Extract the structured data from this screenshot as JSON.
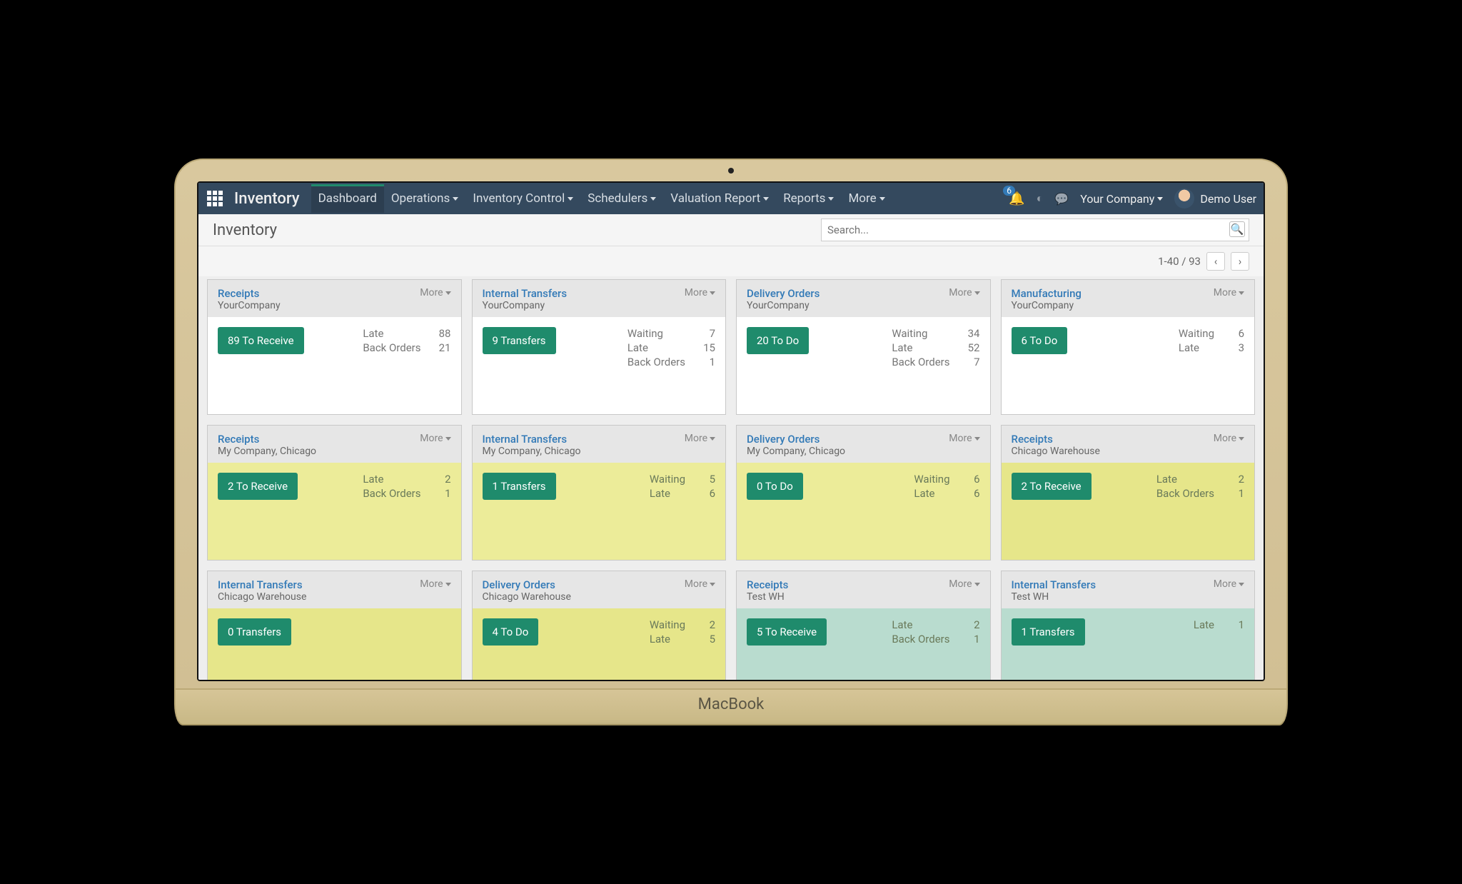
{
  "nav": {
    "brand": "Inventory",
    "items": [
      {
        "label": "Dashboard",
        "active": true,
        "caret": false
      },
      {
        "label": "Operations",
        "active": false,
        "caret": true
      },
      {
        "label": "Inventory Control",
        "active": false,
        "caret": true
      },
      {
        "label": "Schedulers",
        "active": false,
        "caret": true
      },
      {
        "label": "Valuation Report",
        "active": false,
        "caret": true
      },
      {
        "label": "Reports",
        "active": false,
        "caret": true
      },
      {
        "label": "More",
        "active": false,
        "caret": true
      }
    ],
    "notif_count": "6",
    "company": "Your Company",
    "user": "Demo User"
  },
  "page": {
    "title": "Inventory",
    "search_placeholder": "Search...",
    "pager": "1-40 / 93"
  },
  "more_label": "More",
  "cards": [
    {
      "title": "Receipts",
      "sub": "YourCompany",
      "btn": "89 To Receive",
      "tint": "",
      "stats": [
        {
          "k": "Late",
          "v": "88"
        },
        {
          "k": "Back Orders",
          "v": "21"
        }
      ]
    },
    {
      "title": "Internal Transfers",
      "sub": "YourCompany",
      "btn": "9 Transfers",
      "tint": "",
      "stats": [
        {
          "k": "Waiting",
          "v": "7"
        },
        {
          "k": "Late",
          "v": "15"
        },
        {
          "k": "Back Orders",
          "v": "1"
        }
      ]
    },
    {
      "title": "Delivery Orders",
      "sub": "YourCompany",
      "btn": "20 To Do",
      "tint": "",
      "stats": [
        {
          "k": "Waiting",
          "v": "34"
        },
        {
          "k": "Late",
          "v": "52"
        },
        {
          "k": "Back Orders",
          "v": "7"
        }
      ]
    },
    {
      "title": "Manufacturing",
      "sub": "YourCompany",
      "btn": "6 To Do",
      "tint": "",
      "stats": [
        {
          "k": "Waiting",
          "v": "6"
        },
        {
          "k": "Late",
          "v": "3"
        }
      ]
    },
    {
      "title": "Receipts",
      "sub": "My Company, Chicago",
      "btn": "2 To Receive",
      "tint": "body-tint-yellow",
      "stats": [
        {
          "k": "Late",
          "v": "2"
        },
        {
          "k": "Back Orders",
          "v": "1"
        }
      ]
    },
    {
      "title": "Internal Transfers",
      "sub": "My Company, Chicago",
      "btn": "1 Transfers",
      "tint": "body-tint-yellow",
      "stats": [
        {
          "k": "Waiting",
          "v": "5"
        },
        {
          "k": "Late",
          "v": "6"
        }
      ]
    },
    {
      "title": "Delivery Orders",
      "sub": "My Company, Chicago",
      "btn": "0 To Do",
      "tint": "body-tint-yellow",
      "stats": [
        {
          "k": "Waiting",
          "v": "6"
        },
        {
          "k": "Late",
          "v": "6"
        }
      ]
    },
    {
      "title": "Receipts",
      "sub": "Chicago Warehouse",
      "btn": "2 To Receive",
      "tint": "body-tint-yellow2",
      "stats": [
        {
          "k": "Late",
          "v": "2"
        },
        {
          "k": "Back Orders",
          "v": "1"
        }
      ]
    },
    {
      "title": "Internal Transfers",
      "sub": "Chicago Warehouse",
      "btn": "0 Transfers",
      "tint": "body-tint-yellow2",
      "stats": []
    },
    {
      "title": "Delivery Orders",
      "sub": "Chicago Warehouse",
      "btn": "4 To Do",
      "tint": "body-tint-yellow2",
      "stats": [
        {
          "k": "Waiting",
          "v": "2"
        },
        {
          "k": "Late",
          "v": "5"
        }
      ]
    },
    {
      "title": "Receipts",
      "sub": "Test WH",
      "btn": "5 To Receive",
      "tint": "body-tint-teal",
      "stats": [
        {
          "k": "Late",
          "v": "2"
        },
        {
          "k": "Back Orders",
          "v": "1"
        }
      ]
    },
    {
      "title": "Internal Transfers",
      "sub": "Test WH",
      "btn": "1 Transfers",
      "tint": "body-tint-teal",
      "stats": [
        {
          "k": "Late",
          "v": "1"
        }
      ]
    }
  ],
  "laptop_label": "MacBook"
}
